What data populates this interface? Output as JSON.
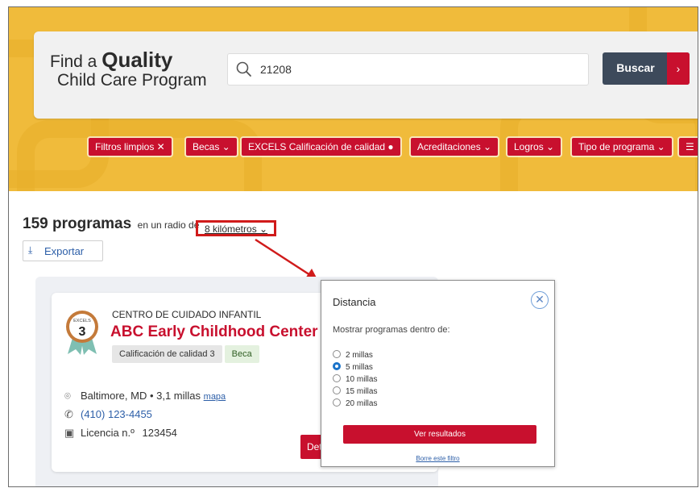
{
  "brand": {
    "find_a": "Find a",
    "quality": "Quality",
    "line2": "Child Care Program"
  },
  "search": {
    "value": "21208",
    "button_label": "Buscar",
    "button_arrow": "›"
  },
  "filters": [
    {
      "label": "Filtros limpios ✕"
    },
    {
      "label": "Becas ⌄"
    },
    {
      "label": "EXCELS Calificación de calidad ●"
    },
    {
      "label": "Acreditaciones ⌄"
    },
    {
      "label": "Logros ⌄"
    },
    {
      "label": "Tipo de programa ⌄"
    },
    {
      "label": "☰"
    }
  ],
  "results": {
    "count": "159 programas",
    "radius_prefix": "en un radio de",
    "radius_value": "8 kilómetros ⌄",
    "export_icon": "⤓",
    "export_label": "Exportar"
  },
  "card": {
    "badge_label": "EXCELS",
    "badge_number": "3",
    "type": "CENTRO DE CUIDADO INFANTIL",
    "name": "ABC Early Childhood Center",
    "tags": [
      "Calificación de calidad 3",
      "Beca"
    ],
    "location": "Baltimore, MD • 3,1 millas",
    "map_link": "mapa",
    "phone": "(410) 123-4455",
    "license_label": "Licencia n.º",
    "license_number": "123454",
    "detail_button": "Detalles"
  },
  "popup": {
    "title": "Distancia",
    "close": "✕",
    "subtitle": "Mostrar programas dentro de:",
    "options": [
      "2 millas",
      "5 millas",
      "10 millas",
      "15 millas",
      "20 millas"
    ],
    "selected_index": 1,
    "submit": "Ver resultados",
    "clear": "Borre este filtro"
  },
  "colors": {
    "hero": "#f0bb3b",
    "accent": "#c8102e",
    "button_dark": "#3d4a5b",
    "link": "#2d5fa8",
    "radio_selected": "#1a73c9",
    "highlight": "#d01b1b"
  },
  "icons": {
    "search": "search-icon",
    "export": "download-icon",
    "location": "location-pin-icon",
    "phone": "phone-icon",
    "license": "id-card-icon",
    "close": "close-icon"
  }
}
